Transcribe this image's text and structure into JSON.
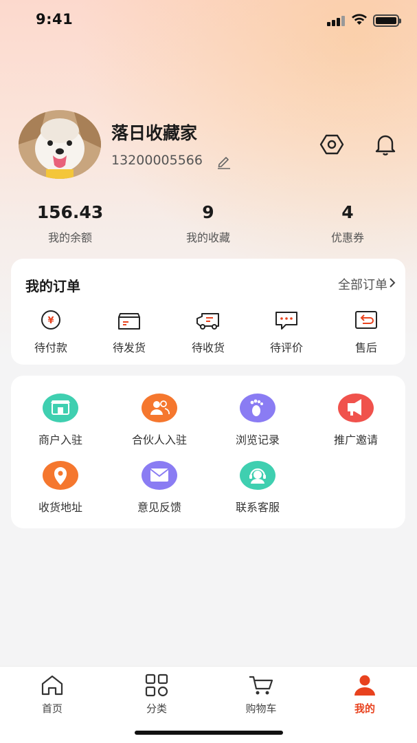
{
  "status_bar": {
    "time": "9:41"
  },
  "profile": {
    "name": "落日收藏家",
    "phone": "13200005566"
  },
  "stats": [
    {
      "value": "156.43",
      "label": "我的余额"
    },
    {
      "value": "9",
      "label": "我的收藏"
    },
    {
      "value": "4",
      "label": "优惠券"
    }
  ],
  "orders": {
    "title": "我的订单",
    "all_label": "全部订单",
    "items": [
      {
        "label": "待付款",
        "icon": "yuan-coin-icon"
      },
      {
        "label": "待发货",
        "icon": "package-box-icon"
      },
      {
        "label": "待收货",
        "icon": "delivery-truck-icon"
      },
      {
        "label": "待评价",
        "icon": "comment-icon"
      },
      {
        "label": "售后",
        "icon": "return-icon"
      }
    ]
  },
  "services": {
    "items": [
      {
        "label": "商户入驻",
        "icon": "store-icon",
        "color": "#3fcfb0"
      },
      {
        "label": "合伙人入驻",
        "icon": "partners-icon",
        "color": "#f5772e"
      },
      {
        "label": "浏览记录",
        "icon": "footprint-icon",
        "color": "#8a7cf3"
      },
      {
        "label": "推广邀请",
        "icon": "megaphone-icon",
        "color": "#f0524c"
      },
      {
        "label": "收货地址",
        "icon": "location-pin-icon",
        "color": "#f5772e"
      },
      {
        "label": "意见反馈",
        "icon": "mail-icon",
        "color": "#8a7cf3"
      },
      {
        "label": "联系客服",
        "icon": "customer-service-icon",
        "color": "#3fcfb0"
      }
    ]
  },
  "tab_bar": {
    "items": [
      {
        "label": "首页",
        "icon": "home-icon",
        "active": false
      },
      {
        "label": "分类",
        "icon": "grid-icon",
        "active": false
      },
      {
        "label": "购物车",
        "icon": "cart-icon",
        "active": false
      },
      {
        "label": "我的",
        "icon": "user-icon",
        "active": true
      }
    ]
  },
  "colors": {
    "accent": "#e8421e",
    "order_icon": "#e8421e"
  }
}
